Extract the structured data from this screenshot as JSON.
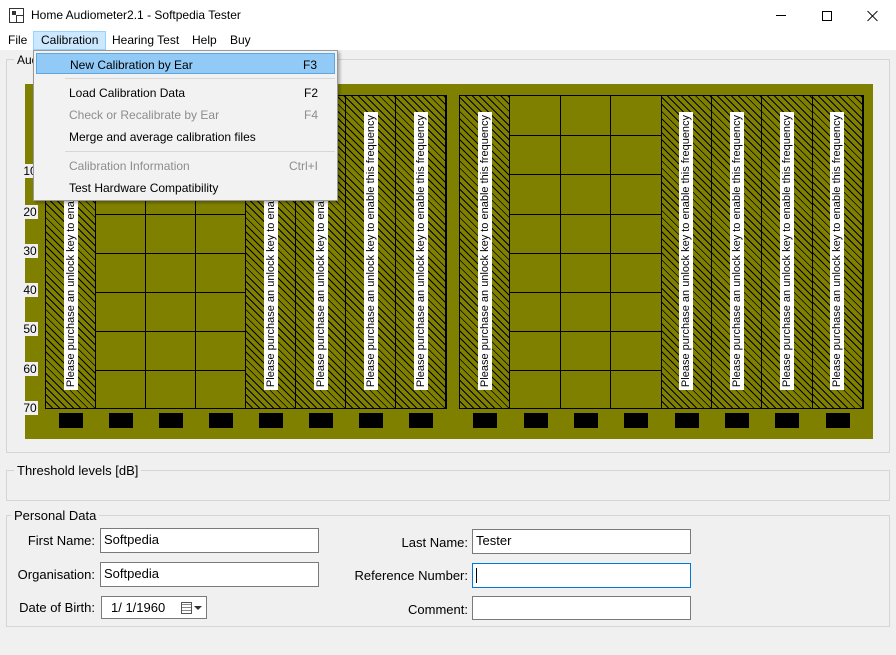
{
  "window": {
    "title": "Home Audiometer2.1 - Softpedia Tester"
  },
  "menubar": {
    "items": [
      "File",
      "Calibration",
      "Hearing Test",
      "Help",
      "Buy"
    ]
  },
  "calibration_menu": {
    "items": [
      {
        "label": "New Calibration by Ear",
        "shortcut": "F3",
        "state": "highlighted"
      },
      {
        "label": "Load Calibration Data",
        "shortcut": "F2",
        "state": "enabled"
      },
      {
        "label": "Check or Recalibrate by Ear",
        "shortcut": "F4",
        "state": "disabled"
      },
      {
        "label": "Merge and average calibration files",
        "shortcut": "",
        "state": "enabled"
      },
      {
        "label": "Calibration Information",
        "shortcut": "Ctrl+I",
        "state": "disabled"
      },
      {
        "label": "Test Hardware Compatibility",
        "shortcut": "",
        "state": "enabled"
      }
    ]
  },
  "audiogram": {
    "group_title": "Audiogram",
    "y_labels": [
      "10",
      "20",
      "30",
      "40",
      "50",
      "60",
      "70"
    ],
    "lock_text": "Please purchase an unlock key to enable this frequency",
    "left_panel_locked": [
      true,
      false,
      false,
      false,
      true,
      true,
      true,
      true
    ],
    "right_panel_locked": [
      true,
      false,
      false,
      false,
      true,
      true,
      true,
      true
    ],
    "colors": {
      "background": "#808000",
      "grid": "#000000"
    }
  },
  "threshold": {
    "title": "Threshold levels [dB]"
  },
  "personal_data": {
    "title": "Personal Data",
    "first_name_label": "First Name:",
    "first_name_value": "Softpedia",
    "last_name_label": "Last Name:",
    "last_name_value": "Tester",
    "organisation_label": "Organisation:",
    "organisation_value": "Softpedia",
    "reference_label": "Reference Number:",
    "reference_value": "",
    "dob_label": "Date of Birth:",
    "dob_value": "1/  1/1960",
    "comment_label": "Comment:",
    "comment_value": ""
  }
}
